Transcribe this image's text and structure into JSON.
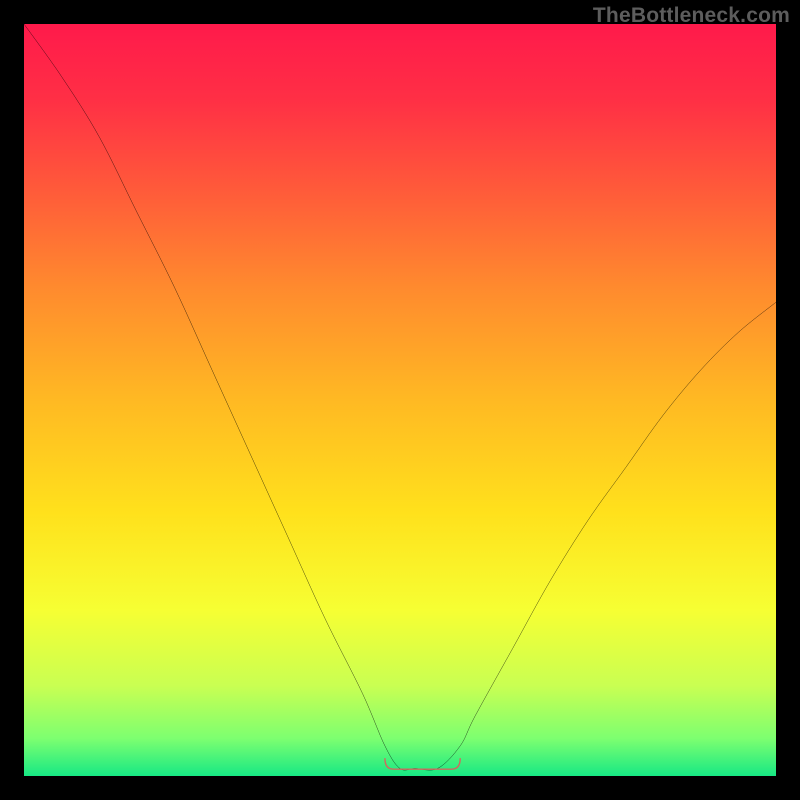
{
  "watermark": "TheBottleneck.com",
  "colors": {
    "gradient_stops": [
      {
        "offset": 0.0,
        "color": "#ff1a4b"
      },
      {
        "offset": 0.1,
        "color": "#ff2f45"
      },
      {
        "offset": 0.22,
        "color": "#ff5a3a"
      },
      {
        "offset": 0.35,
        "color": "#ff8a2e"
      },
      {
        "offset": 0.5,
        "color": "#ffb923"
      },
      {
        "offset": 0.65,
        "color": "#ffe11c"
      },
      {
        "offset": 0.78,
        "color": "#f6ff33"
      },
      {
        "offset": 0.88,
        "color": "#c9ff52"
      },
      {
        "offset": 0.95,
        "color": "#7dff70"
      },
      {
        "offset": 1.0,
        "color": "#17e884"
      }
    ],
    "curve": "#000000",
    "flat_segment": "#cf6a5f",
    "frame": "#000000"
  },
  "chart_data": {
    "type": "line",
    "title": "",
    "xlabel": "",
    "ylabel": "",
    "xlim": [
      0,
      100
    ],
    "ylim": [
      0,
      100
    ],
    "grid": false,
    "legend": false,
    "series": [
      {
        "name": "bottleneck-curve",
        "x": [
          0,
          5,
          10,
          15,
          20,
          25,
          30,
          35,
          40,
          45,
          48,
          50,
          52,
          55,
          58,
          60,
          65,
          70,
          75,
          80,
          85,
          90,
          95,
          100
        ],
        "y": [
          100,
          93,
          85,
          75,
          65,
          54,
          43,
          32,
          21,
          11,
          4,
          1,
          1,
          1,
          4,
          8,
          17,
          26,
          34,
          41,
          48,
          54,
          59,
          63
        ]
      }
    ],
    "annotations": [
      {
        "name": "optimal-range",
        "x_start": 48,
        "x_end": 58,
        "y": 1.2,
        "color": "#cf6a5f"
      }
    ]
  }
}
